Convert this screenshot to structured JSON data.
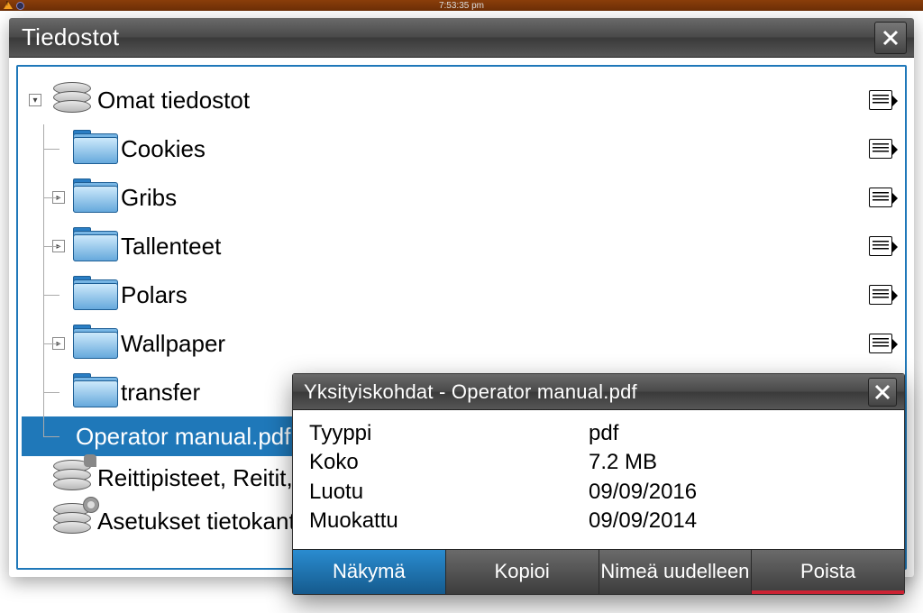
{
  "statusbar": {
    "time": "7:53:35 pm"
  },
  "filewin": {
    "title": "Tiedostot",
    "root": {
      "label": "Omat tiedostot"
    },
    "items": [
      {
        "label": "Cookies",
        "expand": ""
      },
      {
        "label": "Gribs",
        "expand": "▸"
      },
      {
        "label": "Tallenteet",
        "expand": "▸"
      },
      {
        "label": "Polars",
        "expand": ""
      },
      {
        "label": "Wallpaper",
        "expand": "▸"
      },
      {
        "label": "transfer",
        "expand": ""
      }
    ],
    "selected_file": "Operator manual.pdf",
    "waypoints": "Reittipisteet, Reitit, Jäljet ...",
    "settingsdb": "Asetukset tietokanta"
  },
  "details": {
    "title": "Yksityiskohdat - Operator manual.pdf",
    "rows": [
      {
        "k": "Tyyppi",
        "v": "pdf"
      },
      {
        "k": "Koko",
        "v": "7.2 MB"
      },
      {
        "k": "Luotu",
        "v": "09/09/2016"
      },
      {
        "k": "Muokattu",
        "v": "09/09/2014"
      }
    ],
    "buttons": {
      "view": "Näkymä",
      "copy": "Kopioi",
      "rename": "Nimeä uudelleen",
      "delete": "Poista"
    }
  }
}
